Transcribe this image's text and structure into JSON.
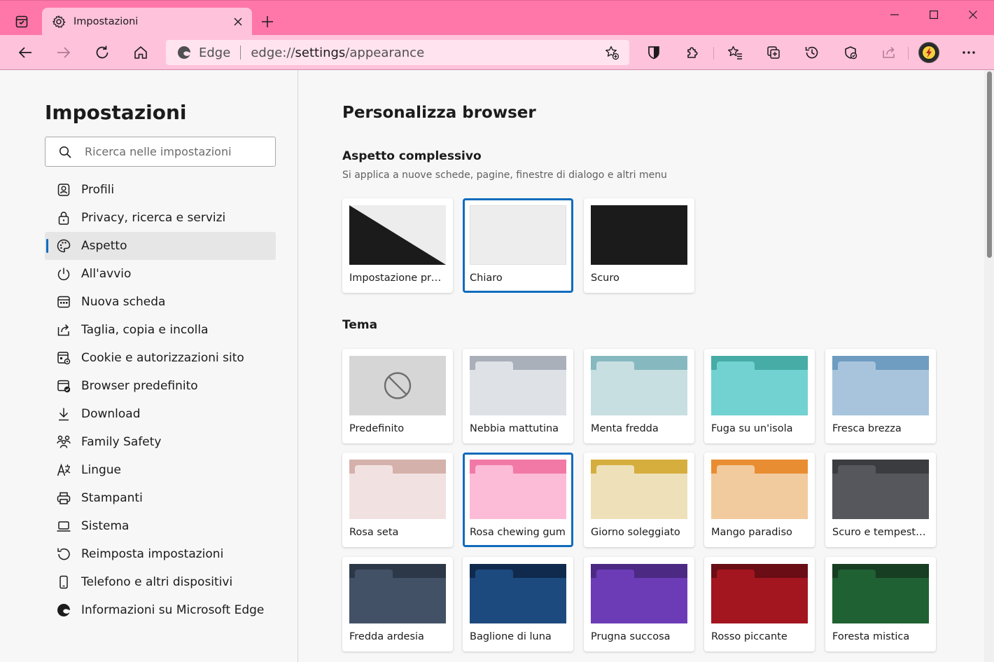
{
  "window": {
    "tab_title": "Impostazioni"
  },
  "address_bar": {
    "site_label": "Edge",
    "url_prefix": "edge://",
    "url_bold": "settings",
    "url_suffix": "/appearance"
  },
  "sidebar": {
    "title": "Impostazioni",
    "search_placeholder": "Ricerca nelle impostazioni",
    "items": [
      {
        "label": "Profili",
        "icon": "profile-icon"
      },
      {
        "label": "Privacy, ricerca e servizi",
        "icon": "lock-icon"
      },
      {
        "label": "Aspetto",
        "icon": "palette-icon",
        "active": true
      },
      {
        "label": "All'avvio",
        "icon": "power-icon"
      },
      {
        "label": "Nuova scheda",
        "icon": "new-tab-page-icon"
      },
      {
        "label": "Taglia, copia e incolla",
        "icon": "share-arrow-icon"
      },
      {
        "label": "Cookie e autorizzazioni sito",
        "icon": "cookie-settings-icon"
      },
      {
        "label": "Browser predefinito",
        "icon": "default-browser-icon"
      },
      {
        "label": "Download",
        "icon": "download-icon"
      },
      {
        "label": "Family Safety",
        "icon": "family-icon"
      },
      {
        "label": "Lingue",
        "icon": "language-icon"
      },
      {
        "label": "Stampanti",
        "icon": "printer-icon"
      },
      {
        "label": "Sistema",
        "icon": "laptop-icon"
      },
      {
        "label": "Reimposta impostazioni",
        "icon": "reset-icon"
      },
      {
        "label": "Telefono e altri dispositivi",
        "icon": "phone-icon"
      },
      {
        "label": "Informazioni su Microsoft Edge",
        "icon": "edge-logo-icon"
      }
    ]
  },
  "main": {
    "page_title": "Personalizza browser",
    "appearance": {
      "title": "Aspetto complessivo",
      "subtitle": "Si applica a nuove schede, pagine, finestre di dialogo e altri menu",
      "options": [
        {
          "label": "Impostazione predefinita di sistema",
          "type": "system",
          "selected": false
        },
        {
          "label": "Chiaro",
          "type": "light",
          "selected": true
        },
        {
          "label": "Scuro",
          "type": "dark",
          "selected": false
        }
      ]
    },
    "theme": {
      "title": "Tema",
      "options": [
        {
          "label": "Predefinito",
          "type": "none",
          "selected": false
        },
        {
          "label": "Nebbia mattutina",
          "top": "#a9b0ba",
          "tab": "#dee1e6",
          "body": "#dee1e6",
          "selected": false
        },
        {
          "label": "Menta fredda",
          "top": "#86b9bf",
          "tab": "#c8dfe2",
          "body": "#c8dfe2",
          "selected": false
        },
        {
          "label": "Fuga su un'isola",
          "top": "#47aca6",
          "tab": "#72d1d1",
          "body": "#72d1d1",
          "selected": false
        },
        {
          "label": "Fresca brezza",
          "top": "#6f9cc1",
          "tab": "#a8c4dc",
          "body": "#a8c4dc",
          "selected": false
        },
        {
          "label": "Rosa seta",
          "top": "#d5b1ab",
          "tab": "#f1e2e1",
          "body": "#f1e2e1",
          "selected": false
        },
        {
          "label": "Rosa chewing gum",
          "top": "#f279a6",
          "tab": "#fcbbd6",
          "body": "#fcbbd6",
          "selected": true
        },
        {
          "label": "Giorno soleggiato",
          "top": "#d6ae3e",
          "tab": "#eee1ba",
          "body": "#eee1ba",
          "selected": false
        },
        {
          "label": "Mango paradiso",
          "top": "#e98d32",
          "tab": "#f1cb9e",
          "body": "#f1cb9e",
          "selected": false
        },
        {
          "label": "Scuro e tempestoso",
          "top": "#3a3c40",
          "tab": "#55575c",
          "body": "#55575c",
          "selected": false
        },
        {
          "label": "Fredda ardesia",
          "top": "#2c3848",
          "tab": "#435167",
          "body": "#435167",
          "selected": false
        },
        {
          "label": "Baglione di luna",
          "top": "#102a4e",
          "tab": "#1d4a7e",
          "body": "#1d4a7e",
          "selected": false
        },
        {
          "label": "Prugna succosa",
          "top": "#4c2a84",
          "tab": "#6c3cb6",
          "body": "#6c3cb6",
          "selected": false
        },
        {
          "label": "Rosso piccante",
          "top": "#6a0d15",
          "tab": "#a3151f",
          "body": "#a3151f",
          "selected": false
        },
        {
          "label": "Foresta mistica",
          "top": "#173d22",
          "tab": "#1f6133",
          "body": "#1f6133",
          "selected": false
        }
      ]
    }
  },
  "colors": {
    "titlebar": "#ff77a8",
    "toolbar": "#ffc2db",
    "accent": "#0f6cbd"
  }
}
